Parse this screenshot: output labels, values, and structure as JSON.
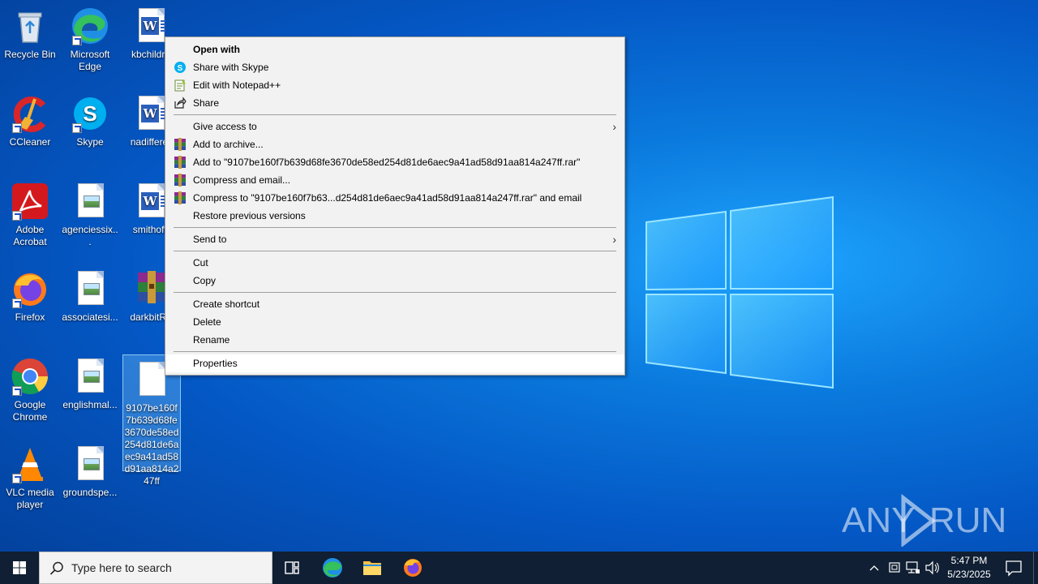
{
  "desktop": {
    "icons": [
      {
        "label": "Recycle Bin",
        "icon": "recycle-bin-icon"
      },
      {
        "label": "Microsoft Edge",
        "icon": "edge-icon"
      },
      {
        "label": "kbchildre",
        "icon": "word-doc-icon"
      },
      {
        "label": "CCleaner",
        "icon": "ccleaner-icon"
      },
      {
        "label": "Skype",
        "icon": "skype-icon"
      },
      {
        "label": "nadifferer",
        "icon": "word-doc-icon"
      },
      {
        "label": "Adobe Acrobat",
        "icon": "acrobat-icon"
      },
      {
        "label": "agenciessix...",
        "icon": "image-file-icon"
      },
      {
        "label": "smithoffi",
        "icon": "word-doc-icon"
      },
      {
        "label": "Firefox",
        "icon": "firefox-icon"
      },
      {
        "label": "associatesi...",
        "icon": "image-file-icon"
      },
      {
        "label": "darkbitRa",
        "icon": "winrar-archive-icon"
      },
      {
        "label": "Google Chrome",
        "icon": "chrome-icon"
      },
      {
        "label": "englishmal...",
        "icon": "image-file-icon"
      },
      {
        "label": "9107be160f7b639d68fe3670de58ed254d81de6aec9a41ad58d91aa814a247ff",
        "icon": "blank-file-icon"
      },
      {
        "label": "VLC media player",
        "icon": "vlc-icon"
      },
      {
        "label": "groundspe...",
        "icon": "image-file-icon"
      }
    ]
  },
  "context_menu": {
    "open_with": "Open with",
    "share_skype": "Share with Skype",
    "edit_notepad": "Edit with Notepad++",
    "share": "Share",
    "give_access": "Give access to",
    "add_archive": "Add to archive...",
    "add_to_rar": "Add to \"9107be160f7b639d68fe3670de58ed254d81de6aec9a41ad58d91aa814a247ff.rar\"",
    "compress_email": "Compress and email...",
    "compress_to_rar_email": "Compress to \"9107be160f7b63...d254d81de6aec9a41ad58d91aa814a247ff.rar\" and email",
    "restore_versions": "Restore previous versions",
    "send_to": "Send to",
    "cut": "Cut",
    "copy": "Copy",
    "create_shortcut": "Create shortcut",
    "delete": "Delete",
    "rename": "Rename",
    "properties": "Properties",
    "submenu_arrow": "›"
  },
  "taskbar": {
    "search_placeholder": "Type here to search",
    "time": "5:47 PM",
    "date": "5/23/2025"
  },
  "watermark": {
    "text_left": "ANY",
    "text_right": "RUN"
  },
  "colors": {
    "taskbar_bg": "#101f33",
    "menu_bg": "#f2f2f2",
    "selection": "#78c8ff"
  }
}
